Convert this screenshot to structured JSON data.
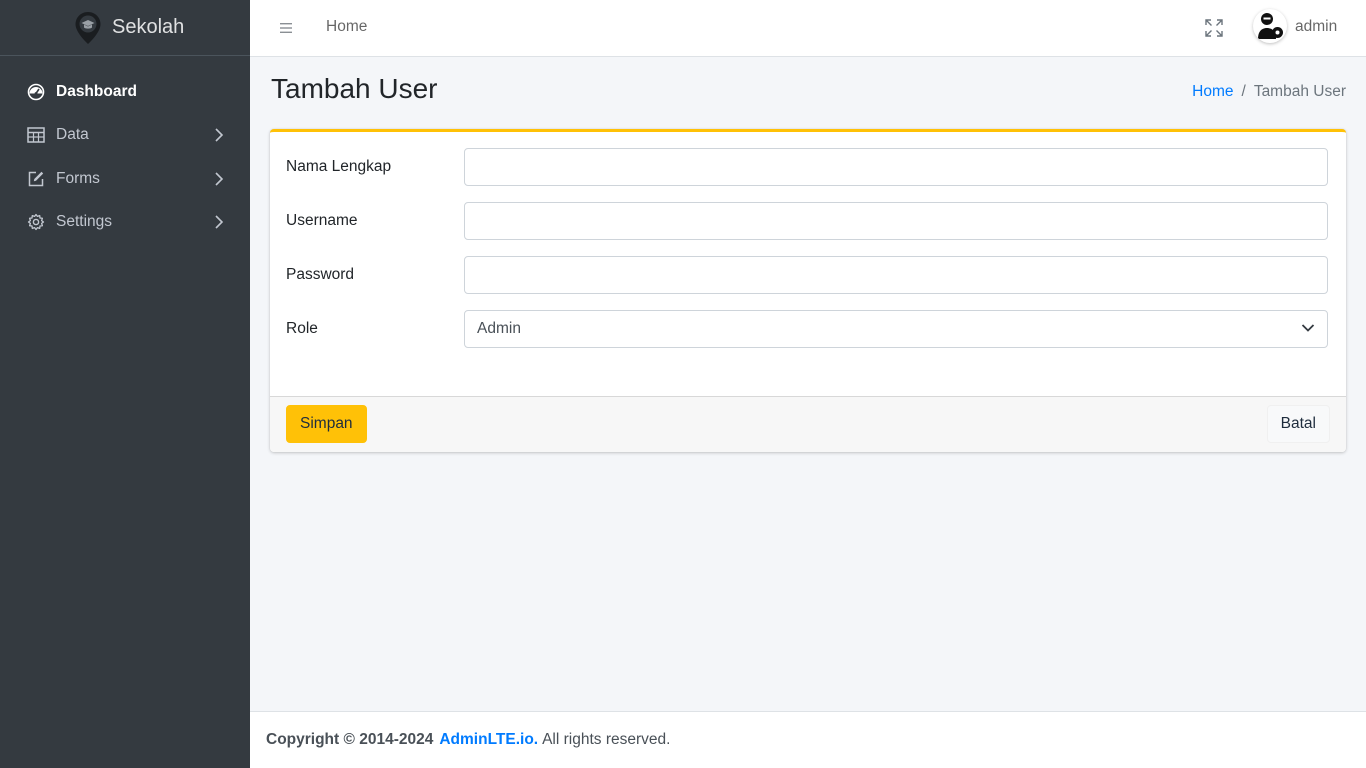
{
  "brand": {
    "name": "Sekolah",
    "logo_icon": "map-pin-graduation-icon"
  },
  "sidebar": {
    "items": [
      {
        "label": "Dashboard",
        "icon": "gauge-icon",
        "active": true
      },
      {
        "label": "Data",
        "icon": "table-icon",
        "has_children": true
      },
      {
        "label": "Forms",
        "icon": "edit-icon",
        "has_children": true
      },
      {
        "label": "Settings",
        "icon": "gear-icon",
        "has_children": true
      }
    ]
  },
  "navbar": {
    "home_label": "Home",
    "user_name": "admin",
    "menu_icon": "hamburger-icon",
    "fullscreen_icon": "fullscreen-icon"
  },
  "header": {
    "title": "Tambah User",
    "breadcrumb": {
      "home": "Home",
      "separator": "/",
      "current": "Tambah User"
    }
  },
  "form": {
    "fields": [
      {
        "label": "Nama Lengkap",
        "value": "",
        "placeholder": ""
      },
      {
        "label": "Username",
        "value": "",
        "placeholder": ""
      },
      {
        "label": "Password",
        "value": "",
        "placeholder": ""
      }
    ],
    "role": {
      "label": "Role",
      "selected": "Admin"
    },
    "save_label": "Simpan",
    "cancel_label": "Batal"
  },
  "footer": {
    "copyright": "Copyright © 2014-2024",
    "link_text": "AdminLTE.io.",
    "rights": "All rights reserved."
  },
  "colors": {
    "sidebar_bg": "#343a40",
    "accent": "#ffc107",
    "link": "#007bff",
    "content_bg": "#f4f6f9"
  }
}
